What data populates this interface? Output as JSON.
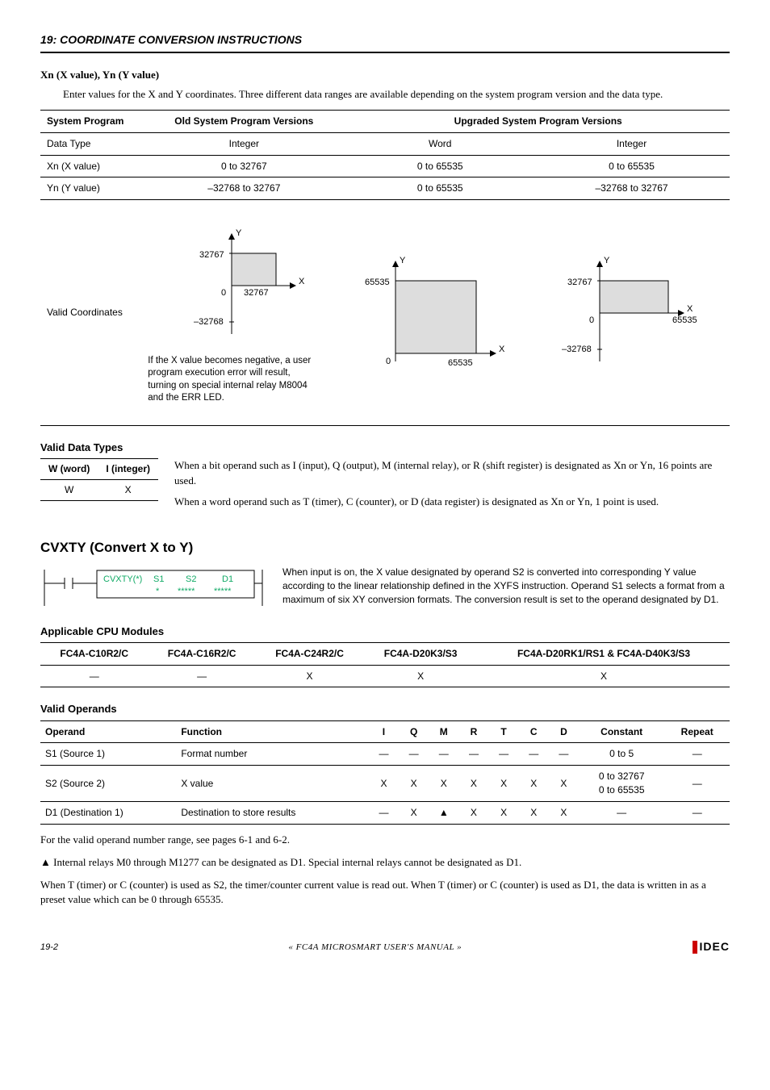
{
  "chapter": {
    "num": "19:",
    "title": "COORDINATE CONVERSION INSTRUCTIONS"
  },
  "section1": {
    "title": "Xn (X value), Yn (Y value)",
    "intro": "Enter values for the X and Y coordinates. Three different data ranges are available depending on the system program version and the data type."
  },
  "table1": {
    "headers": {
      "c1": "System Program",
      "c2": "Old System Program Versions",
      "c3": "Upgraded System Program Versions"
    },
    "r1": {
      "c1": "Data Type",
      "c2": "Integer",
      "c3": "Word",
      "c4": "Integer"
    },
    "r2": {
      "c1": "Xn (X value)",
      "c2": "0 to 32767",
      "c3": "0 to 65535",
      "c4": "0 to 65535"
    },
    "r3": {
      "c1": "Yn (Y value)",
      "c2": "–32768 to 32767",
      "c3": "0 to 65535",
      "c4": "–32768 to 32767"
    },
    "r4": {
      "c1": "Valid Coordinates"
    },
    "diag1": {
      "y": "Y",
      "x": "X",
      "top": "32767",
      "bottom": "–32768",
      "zero": "0",
      "right": "32767",
      "note": "If the X value becomes negative, a user program execution error will result, turning on special internal relay M8004 and the ERR LED."
    },
    "diag2": {
      "y": "Y",
      "x": "X",
      "top": "65535",
      "zero": "0",
      "right": "65535"
    },
    "diag3": {
      "y": "Y",
      "x": "X",
      "top": "32767",
      "bottom": "–32768",
      "zero": "0",
      "right": "65535"
    }
  },
  "validtypes": {
    "head": "Valid Data Types",
    "h1": "W (word)",
    "h2": "I (integer)",
    "v1": "W",
    "v2": "X",
    "p1": "When a bit operand such as I (input), Q (output), M (internal relay), or R (shift register) is designated as Xn or Yn, 16 points are used.",
    "p2": "When a word operand such as T (timer), C (counter), or D (data register) is designated as Xn or Yn, 1 point is used."
  },
  "cvxty": {
    "head": "CVXTY (Convert X to Y)",
    "box": {
      "name": "CVXTY(*)",
      "s1": "S1",
      "s2": "S2",
      "d1": "D1",
      "row2a": "*",
      "row2b": "*****",
      "row2c": "*****"
    },
    "desc": "When input is on, the X value designated by operand S2 is converted into corresponding Y value according to the linear relationship defined in the XYFS instruction. Operand S1 selects a format from a maximum of six XY conversion formats. The conversion result is set to the operand designated by D1."
  },
  "cpu": {
    "head": "Applicable CPU Modules",
    "h1": "FC4A-C10R2/C",
    "h2": "FC4A-C16R2/C",
    "h3": "FC4A-C24R2/C",
    "h4": "FC4A-D20K3/S3",
    "h5": "FC4A-D20RK1/RS1 & FC4A-D40K3/S3",
    "v1": "—",
    "v2": "—",
    "v3": "X",
    "v4": "X",
    "v5": "X"
  },
  "ops": {
    "head": "Valid Operands",
    "headers": {
      "op": "Operand",
      "fn": "Function",
      "i": "I",
      "q": "Q",
      "m": "M",
      "r": "R",
      "t": "T",
      "c": "C",
      "d": "D",
      "const": "Constant",
      "rep": "Repeat"
    },
    "r1": {
      "op": "S1 (Source 1)",
      "fn": "Format number",
      "i": "—",
      "q": "—",
      "m": "—",
      "r": "—",
      "t": "—",
      "c": "—",
      "d": "—",
      "const": "0 to 5",
      "rep": "—"
    },
    "r2": {
      "op": "S2 (Source 2)",
      "fn": "X value",
      "i": "X",
      "q": "X",
      "m": "X",
      "r": "X",
      "t": "X",
      "c": "X",
      "d": "X",
      "const": "0 to 32767\n0 to 65535",
      "rep": "—"
    },
    "r3": {
      "op": "D1 (Destination 1)",
      "fn": "Destination to store results",
      "i": "—",
      "q": "X",
      "m": "▲",
      "r": "X",
      "t": "X",
      "c": "X",
      "d": "X",
      "const": "—",
      "rep": "—"
    }
  },
  "body": {
    "p1": "For the valid operand number range, see pages 6-1 and 6-2.",
    "p2": "▲ Internal relays M0 through M1277 can be designated as D1. Special internal relays cannot be designated as D1.",
    "p3": "When T (timer) or C (counter) is used as S2, the timer/counter current value is read out. When T (timer) or C (counter) is used as D1, the data is written in as a preset value which can be 0 through 65535."
  },
  "footer": {
    "page": "19-2",
    "manual": "« FC4A MICROSMART USER'S MANUAL »",
    "logo": "IDEC"
  }
}
